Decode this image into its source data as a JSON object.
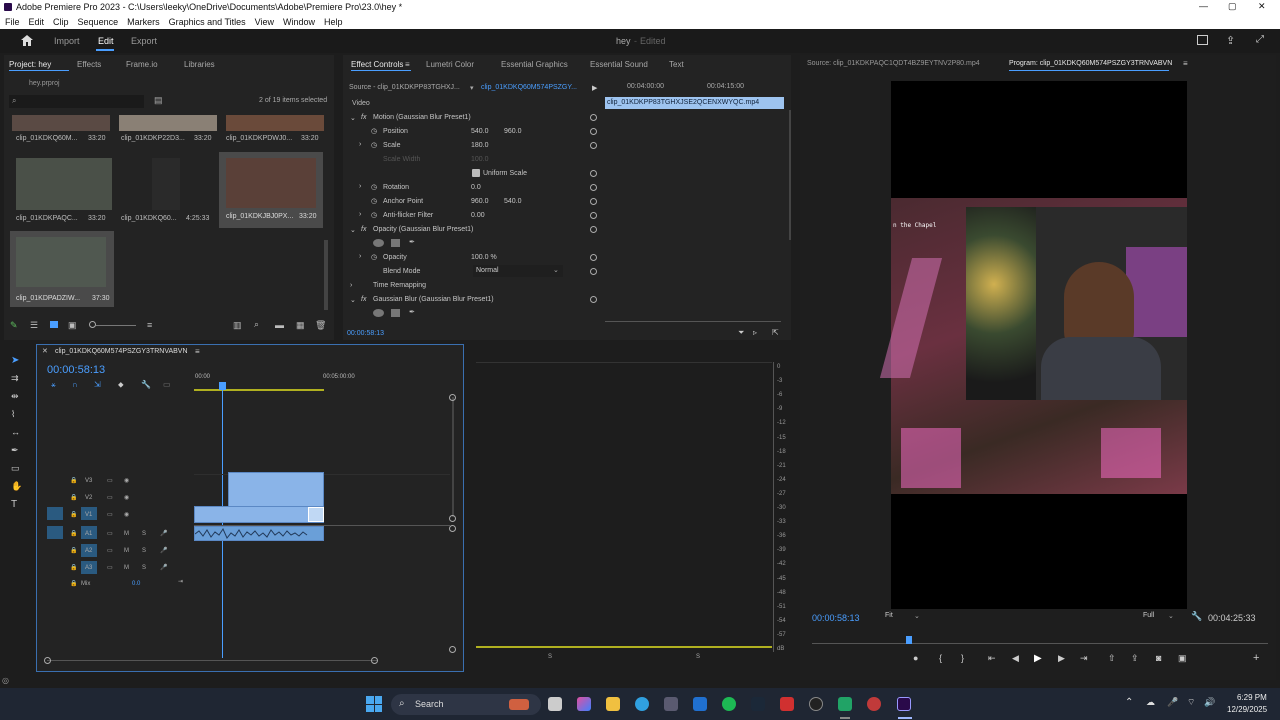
{
  "titlebar": {
    "title": "Adobe Premiere Pro 2023 - C:\\Users\\leeky\\OneDrive\\Documents\\Adobe\\Premiere Pro\\23.0\\hey *",
    "minimize": "—",
    "maximize": "▢",
    "close": "✕"
  },
  "menu": [
    "File",
    "Edit",
    "Clip",
    "Sequence",
    "Markers",
    "Graphics and Titles",
    "View",
    "Window",
    "Help"
  ],
  "workspace": {
    "tabs": [
      "Import",
      "Edit",
      "Export"
    ],
    "active": "Edit",
    "project_name": "hey",
    "status": "Edited"
  },
  "project": {
    "tabs": [
      "Project: hey",
      "Effects",
      "Frame.io",
      "Libraries"
    ],
    "file": "hey.prproj",
    "selection": "2 of 19 items selected",
    "items": [
      {
        "name": "clip_01KDKQ60M...",
        "duration": "33:20"
      },
      {
        "name": "clip_01KDKP22D3...",
        "duration": "33:20"
      },
      {
        "name": "clip_01KDKPDWJ0...",
        "duration": "33:20"
      },
      {
        "name": "clip_01KDKPAQC...",
        "duration": "33:20"
      },
      {
        "name": "clip_01KDKQ60...",
        "duration": "4:25:33"
      },
      {
        "name": "clip_01KDKJBJ0PX...",
        "duration": "33:20"
      },
      {
        "name": "clip_01KDPADZIW...",
        "duration": "37:30"
      }
    ]
  },
  "effect_controls": {
    "tabs": [
      "Effect Controls",
      "Lumetri Color",
      "Essential Graphics",
      "Essential Sound",
      "Text"
    ],
    "source": "Source - clip_01KDKPP83TGHXJ...",
    "target": "clip_01KDKQ60M574PSZGY...",
    "time1": "00:04:00:00",
    "time2": "00:04:15:00",
    "clip_name": "clip_01KDKPP83TGHXJSE2QCENXWYQC.mp4",
    "section": "Video",
    "motion": "Motion (Gaussian Blur Preset1)",
    "position_label": "Position",
    "position_x": "540.0",
    "position_y": "960.0",
    "scale_label": "Scale",
    "scale": "180.0",
    "scale_width_label": "Scale Width",
    "scale_width": "100.0",
    "uniform_scale": "Uniform Scale",
    "rotation_label": "Rotation",
    "rotation": "0.0",
    "anchor_label": "Anchor Point",
    "anchor_x": "960.0",
    "anchor_y": "540.0",
    "antiflicker_label": "Anti-flicker Filter",
    "antiflicker": "0.00",
    "opacity_header": "Opacity (Gaussian Blur Preset1)",
    "opacity_label": "Opacity",
    "opacity": "100.0 %",
    "blend_label": "Blend Mode",
    "blend": "Normal",
    "time_remap": "Time Remapping",
    "gaussian": "Gaussian Blur (Gaussian Blur Preset1)",
    "timecode": "00:00:58:13"
  },
  "source_tab": "Source: clip_01KDKPAQC1QDT4BZ9EYTNV2P80.mp4",
  "program_tab": "Program: clip_01KDKQ60M574PSZGY3TRNVABVN",
  "program": {
    "timecode": "00:00:58:13",
    "fit": "Fit",
    "quality": "Full",
    "duration": "00:04:25:33",
    "overlay_text": "n the Chapel"
  },
  "timeline": {
    "sequence": "clip_01KDKQ60M574PSZGY3TRNVABVN",
    "timecode": "00:00:58:13",
    "ruler": [
      "00:00",
      "00:05:00:00"
    ],
    "video_tracks": [
      "V3",
      "V2",
      "V1"
    ],
    "audio_tracks": [
      "A1",
      "A2",
      "A3"
    ],
    "mix_label": "Mix",
    "mix_value": "0.0",
    "m": "M",
    "s": "S"
  },
  "meter": [
    "0",
    "-3",
    "-6",
    "-9",
    "-12",
    "-15",
    "-18",
    "-21",
    "-24",
    "-27",
    "-30",
    "-33",
    "-36",
    "-39",
    "-42",
    "-45",
    "-48",
    "-51",
    "-54",
    "-57",
    "dB"
  ],
  "meter_bottom": [
    "S",
    "S"
  ],
  "taskbar": {
    "search": "Search",
    "time": "6:29 PM",
    "date": "12/29/2025"
  }
}
